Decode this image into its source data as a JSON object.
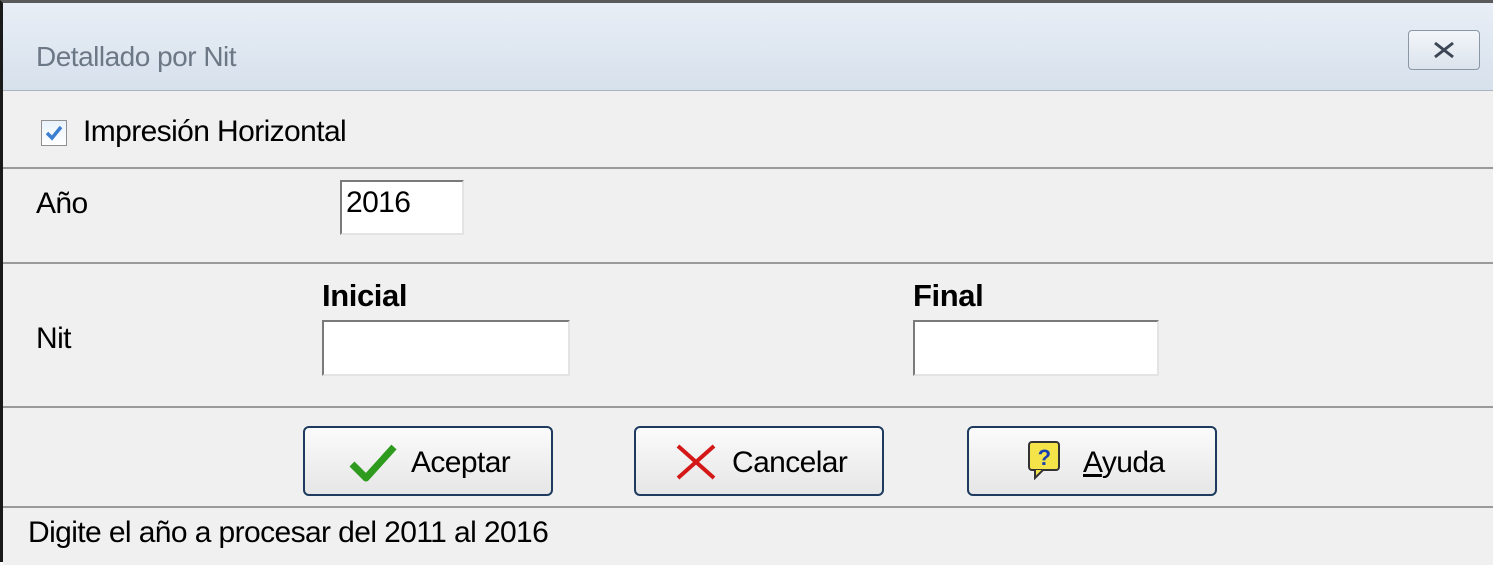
{
  "window": {
    "title": "Detallado por Nit"
  },
  "options": {
    "horizontal_print_label": "Impresión Horizontal",
    "horizontal_print_checked": true
  },
  "year": {
    "label": "Año",
    "value": "2016"
  },
  "nit": {
    "label": "Nit",
    "initial_label": "Inicial",
    "final_label": "Final",
    "initial_value": "",
    "final_value": ""
  },
  "buttons": {
    "accept": "Aceptar",
    "cancel": "Cancelar",
    "help_prefix": "A",
    "help_rest": "yuda"
  },
  "status": {
    "text": "Digite el año a procesar del 2011 al 2016"
  },
  "icons": {
    "accept": "checkmark-icon",
    "cancel": "x-icon",
    "help": "help-icon",
    "close": "close-icon"
  },
  "colors": {
    "accept_green": "#2e9a1e",
    "cancel_red": "#d41818",
    "button_border": "#1e3a5f",
    "checkbox_tick": "#3a7fd1"
  }
}
